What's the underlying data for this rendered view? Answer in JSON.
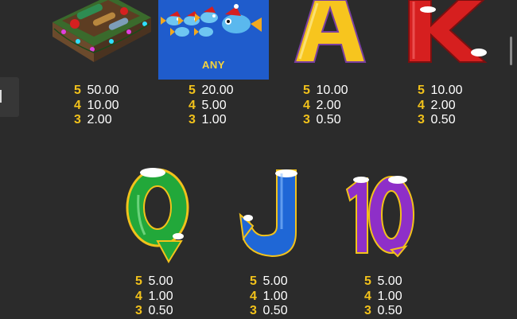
{
  "symbols": [
    {
      "name": "tackle-box",
      "icon": "tackle-box-icon",
      "pays": [
        {
          "count": "5",
          "value": "50.00"
        },
        {
          "count": "4",
          "value": "10.00"
        },
        {
          "count": "3",
          "value": "2.00"
        }
      ]
    },
    {
      "name": "fish-scatter",
      "icon": "fish-group-icon",
      "label": "ANY",
      "pays": [
        {
          "count": "5",
          "value": "20.00"
        },
        {
          "count": "4",
          "value": "5.00"
        },
        {
          "count": "3",
          "value": "1.00"
        }
      ]
    },
    {
      "name": "letter-a",
      "icon": "letter-a-icon",
      "pays": [
        {
          "count": "5",
          "value": "10.00"
        },
        {
          "count": "4",
          "value": "2.00"
        },
        {
          "count": "3",
          "value": "0.50"
        }
      ]
    },
    {
      "name": "letter-k",
      "icon": "letter-k-icon",
      "pays": [
        {
          "count": "5",
          "value": "10.00"
        },
        {
          "count": "4",
          "value": "2.00"
        },
        {
          "count": "3",
          "value": "0.50"
        }
      ]
    },
    {
      "name": "letter-q",
      "icon": "letter-q-icon",
      "pays": [
        {
          "count": "5",
          "value": "5.00"
        },
        {
          "count": "4",
          "value": "1.00"
        },
        {
          "count": "3",
          "value": "0.50"
        }
      ]
    },
    {
      "name": "letter-j",
      "icon": "letter-j-icon",
      "pays": [
        {
          "count": "5",
          "value": "5.00"
        },
        {
          "count": "4",
          "value": "1.00"
        },
        {
          "count": "3",
          "value": "0.50"
        }
      ]
    },
    {
      "name": "number-10",
      "icon": "number-10-icon",
      "pays": [
        {
          "count": "5",
          "value": "5.00"
        },
        {
          "count": "4",
          "value": "1.00"
        },
        {
          "count": "3",
          "value": "0.50"
        }
      ]
    }
  ],
  "colors": {
    "background": "#2b2b2b",
    "count": "#f2c21b",
    "value": "#ffffff",
    "any_box": "#1f5ccc",
    "a_yellow": "#f7c51e",
    "k_red": "#d61f1f",
    "q_green": "#22a83a",
    "j_blue": "#1f67d6",
    "ten_purple": "#8e2fc8"
  }
}
